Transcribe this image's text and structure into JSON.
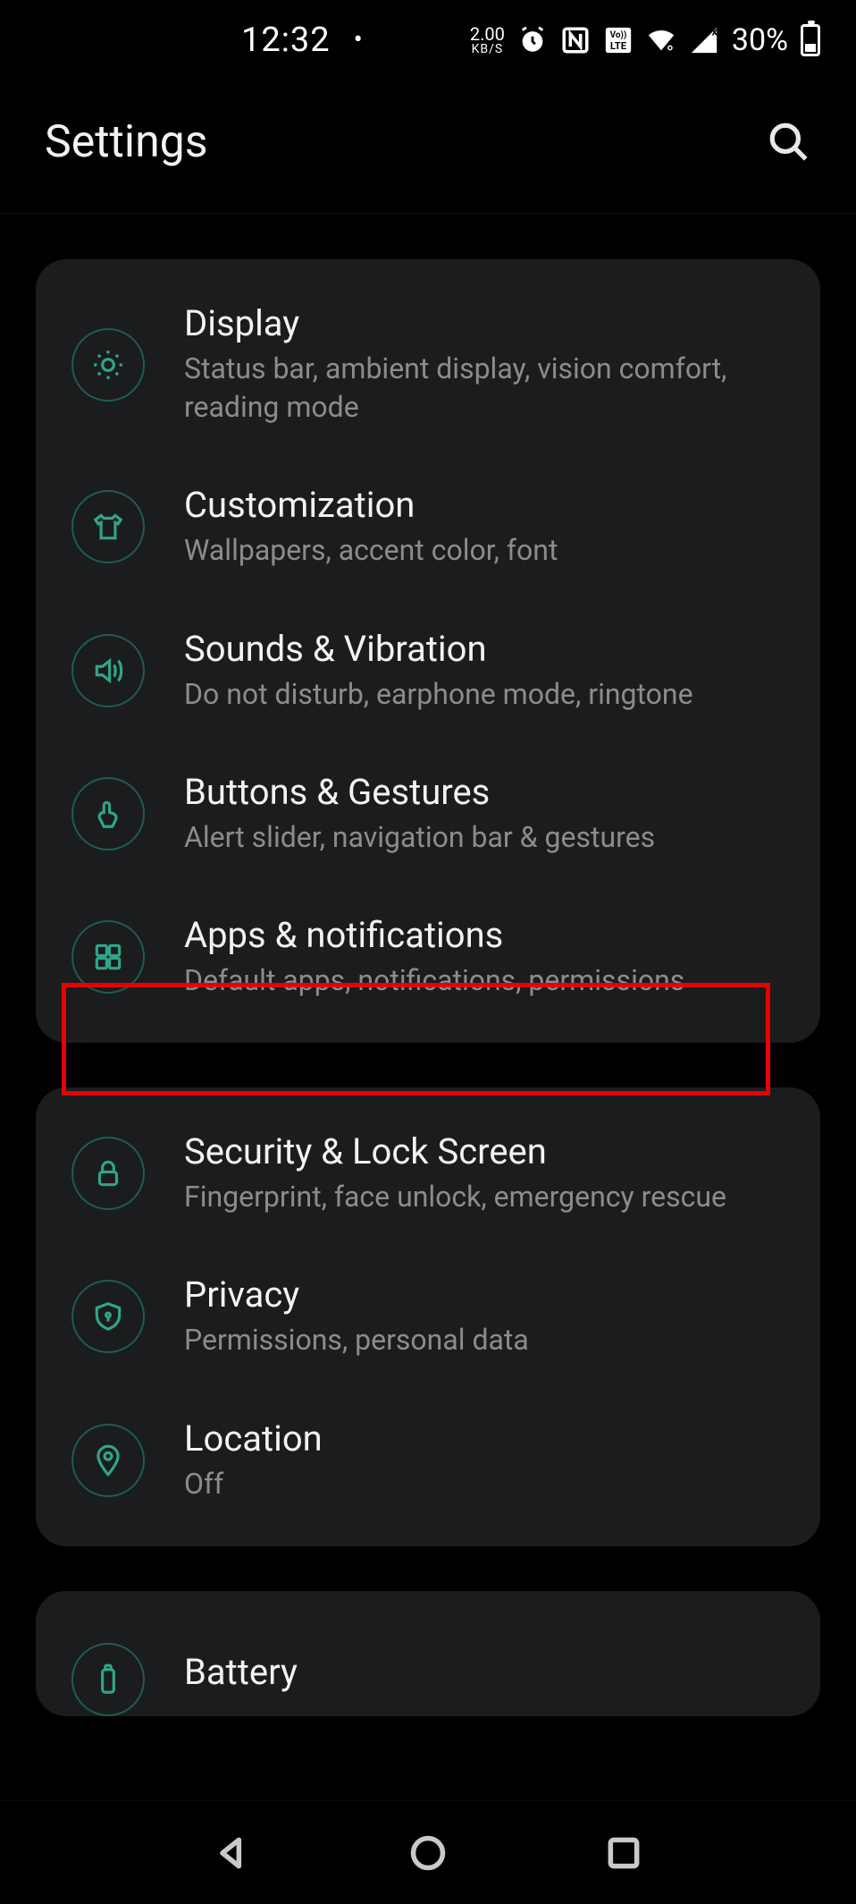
{
  "status": {
    "time": "12:32",
    "speed_value": "2.00",
    "speed_unit": "KB/S",
    "battery_pct": "30%"
  },
  "header": {
    "title": "Settings"
  },
  "groups": [
    {
      "items": [
        {
          "icon": "brightness",
          "title": "Display",
          "subtitle": "Status bar, ambient display, vision comfort, reading mode"
        },
        {
          "icon": "tshirt",
          "title": "Customization",
          "subtitle": "Wallpapers, accent color, font"
        },
        {
          "icon": "speaker",
          "title": "Sounds & Vibration",
          "subtitle": "Do not disturb, earphone mode, ringtone"
        },
        {
          "icon": "gesture",
          "title": "Buttons & Gestures",
          "subtitle": "Alert slider, navigation bar & gestures"
        },
        {
          "icon": "apps",
          "title": "Apps & notifications",
          "subtitle": "Default apps, notifications, permissions",
          "highlighted": true
        }
      ]
    },
    {
      "items": [
        {
          "icon": "lock",
          "title": "Security & Lock Screen",
          "subtitle": "Fingerprint, face unlock, emergency rescue"
        },
        {
          "icon": "shield",
          "title": "Privacy",
          "subtitle": "Permissions, personal data"
        },
        {
          "icon": "location",
          "title": "Location",
          "subtitle": "Off"
        }
      ]
    },
    {
      "items": [
        {
          "icon": "battery",
          "title": "Battery",
          "subtitle": ""
        }
      ]
    }
  ]
}
